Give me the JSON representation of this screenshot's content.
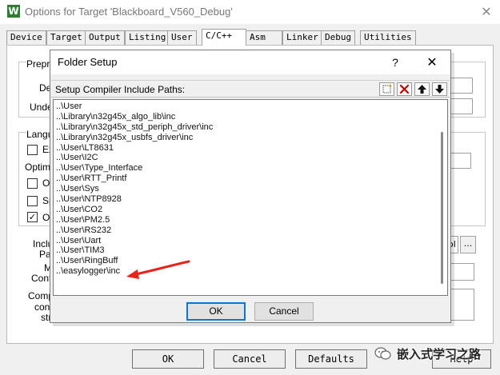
{
  "outer_window": {
    "title": "Options for Target 'Blackboard_V560_Debug'",
    "app_icon_glyph": "W",
    "close_glyph": "✕",
    "tabs": [
      {
        "label": "Device"
      },
      {
        "label": "Target"
      },
      {
        "label": "Output"
      },
      {
        "label": "Listing"
      },
      {
        "label": "User"
      },
      {
        "label": "C/C++"
      },
      {
        "label": "Asm"
      },
      {
        "label": "Linker"
      },
      {
        "label": "Debug"
      },
      {
        "label": "Utilities"
      }
    ],
    "active_tab": "C/C++",
    "visible_fragments": {
      "prepro": "Prepro",
      "def": "Def",
      "undef": "Undef",
      "langu": "Langu",
      "ex": "Ex",
      "optimiz": "Optimiz",
      "op": "Op",
      "sp": "Sp",
      "on": "On",
      "inclu": "Inclu",
      "pat": "Pat",
      "m": "M",
      "contr": "Contr",
      "comp": "Comp",
      "cont": "cont",
      "stri": "stri",
      "ol": "ol",
      "ellipsis": "...",
      "check_glyph": "✓"
    },
    "bottom_buttons": {
      "ok": "OK",
      "cancel": "Cancel",
      "defaults": "Defaults",
      "help": "Help"
    },
    "watermark": "嵌入式学习之路"
  },
  "folder_setup": {
    "title": "Folder Setup",
    "help_glyph": "?",
    "close_glyph": "✕",
    "list_label": "Setup Compiler Include Paths:",
    "toolbar_icons": [
      "new-folder-icon",
      "delete-icon",
      "move-up-icon",
      "move-down-icon"
    ],
    "paths": [
      "..\\User",
      "..\\Library\\n32g45x_algo_lib\\inc",
      "..\\Library\\n32g45x_std_periph_driver\\inc",
      "..\\Library\\n32g45x_usbfs_driver\\inc",
      "..\\User\\LT8631",
      "..\\User\\I2C",
      "..\\User\\Type_Interface",
      "..\\User\\RTT_Printf",
      "..\\User\\Sys",
      "..\\User\\NTP8928",
      "..\\User\\CO2",
      "..\\User\\PM2.5",
      "..\\User\\RS232",
      "..\\User\\Uart",
      "..\\User\\TIM3",
      "..\\User\\RingBuff",
      "..\\easylogger\\inc"
    ],
    "ok_label": "OK",
    "cancel_label": "Cancel",
    "annotation_color": "#e8231b"
  }
}
